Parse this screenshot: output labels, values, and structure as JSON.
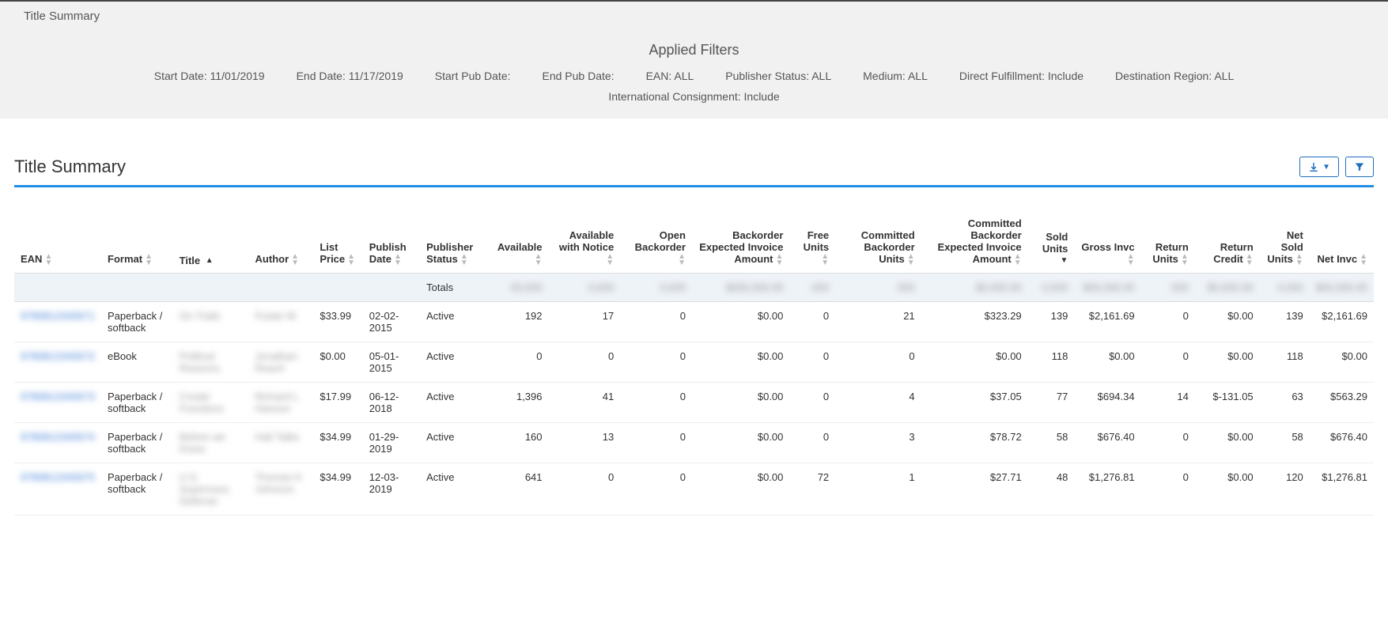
{
  "banner": {
    "title": "Title Summary",
    "applied_filters_heading": "Applied Filters",
    "filters": {
      "start_date": "Start Date: 11/01/2019",
      "end_date": "End Date: 11/17/2019",
      "start_pub_date": "Start Pub Date:",
      "end_pub_date": "End Pub Date:",
      "ean": "EAN: ALL",
      "publisher_status": "Publisher Status: ALL",
      "medium": "Medium: ALL",
      "direct_fulfillment": "Direct Fulfillment: Include",
      "destination_region": "Destination Region: ALL",
      "international_consignment": "International Consignment: Include"
    }
  },
  "section": {
    "title": "Title Summary"
  },
  "table": {
    "columns": {
      "ean": "EAN",
      "format": "Format",
      "title": "Title",
      "author": "Author",
      "list_price": "List Price",
      "publish_date": "Publish Date",
      "publisher_status": "Publisher Status",
      "available": "Available",
      "available_with_notice": "Available with Notice",
      "open_backorder": "Open Backorder",
      "backorder_expected": "Backorder Expected Invoice Amount",
      "free_units": "Free Units",
      "committed_backorder_units": "Committed Backorder Units",
      "committed_backorder_expected": "Committed Backorder Expected Invoice Amount",
      "sold_units": "Sold Units",
      "gross_invc": "Gross Invc",
      "return_units": "Return Units",
      "return_credit": "Return Credit",
      "net_sold_units": "Net Sold Units",
      "net_invc": "Net Invc"
    },
    "totals_label": "Totals",
    "rows": [
      {
        "ean": "9780812345671",
        "format": "Paperback / softback",
        "title": "On Trails",
        "author": "Foster M",
        "list_price": "$33.99",
        "publish_date": "02-02-2015",
        "publisher_status": "Active",
        "available": "192",
        "available_with_notice": "17",
        "open_backorder": "0",
        "backorder_expected": "$0.00",
        "free_units": "0",
        "committed_backorder_units": "21",
        "committed_backorder_expected": "$323.29",
        "sold_units": "139",
        "gross_invc": "$2,161.69",
        "return_units": "0",
        "return_credit": "$0.00",
        "net_sold_units": "139",
        "net_invc": "$2,161.69"
      },
      {
        "ean": "9780812345672",
        "format": "eBook",
        "title": "Political Reasons",
        "author": "Jonathan Reach",
        "list_price": "$0.00",
        "publish_date": "05-01-2015",
        "publisher_status": "Active",
        "available": "0",
        "available_with_notice": "0",
        "open_backorder": "0",
        "backorder_expected": "$0.00",
        "free_units": "0",
        "committed_backorder_units": "0",
        "committed_backorder_expected": "$0.00",
        "sold_units": "118",
        "gross_invc": "$0.00",
        "return_units": "0",
        "return_credit": "$0.00",
        "net_sold_units": "118",
        "net_invc": "$0.00"
      },
      {
        "ean": "9780812345673",
        "format": "Paperback / softback",
        "title": "Create Functions",
        "author": "Richard L Hanson",
        "list_price": "$17.99",
        "publish_date": "06-12-2018",
        "publisher_status": "Active",
        "available": "1,396",
        "available_with_notice": "41",
        "open_backorder": "0",
        "backorder_expected": "$0.00",
        "free_units": "0",
        "committed_backorder_units": "4",
        "committed_backorder_expected": "$37.05",
        "sold_units": "77",
        "gross_invc": "$694.34",
        "return_units": "14",
        "return_credit": "$-131.05",
        "net_sold_units": "63",
        "net_invc": "$563.29"
      },
      {
        "ean": "9780812345674",
        "format": "Paperback / softback",
        "title": "Before we Knew",
        "author": "Hall Talbs",
        "list_price": "$34.99",
        "publish_date": "01-29-2019",
        "publisher_status": "Active",
        "available": "160",
        "available_with_notice": "13",
        "open_backorder": "0",
        "backorder_expected": "$0.00",
        "free_units": "0",
        "committed_backorder_units": "3",
        "committed_backorder_expected": "$78.72",
        "sold_units": "58",
        "gross_invc": "$676.40",
        "return_units": "0",
        "return_credit": "$0.00",
        "net_sold_units": "58",
        "net_invc": "$676.40"
      },
      {
        "ean": "9780812345675",
        "format": "Paperback / softback",
        "title": "U.S. Supernous Defense",
        "author": "Thomas K Johnson",
        "list_price": "$34.99",
        "publish_date": "12-03-2019",
        "publisher_status": "Active",
        "available": "641",
        "available_with_notice": "0",
        "open_backorder": "0",
        "backorder_expected": "$0.00",
        "free_units": "72",
        "committed_backorder_units": "1",
        "committed_backorder_expected": "$27.71",
        "sold_units": "48",
        "gross_invc": "$1,276.81",
        "return_units": "0",
        "return_credit": "$0.00",
        "net_sold_units": "120",
        "net_invc": "$1,276.81"
      }
    ]
  }
}
